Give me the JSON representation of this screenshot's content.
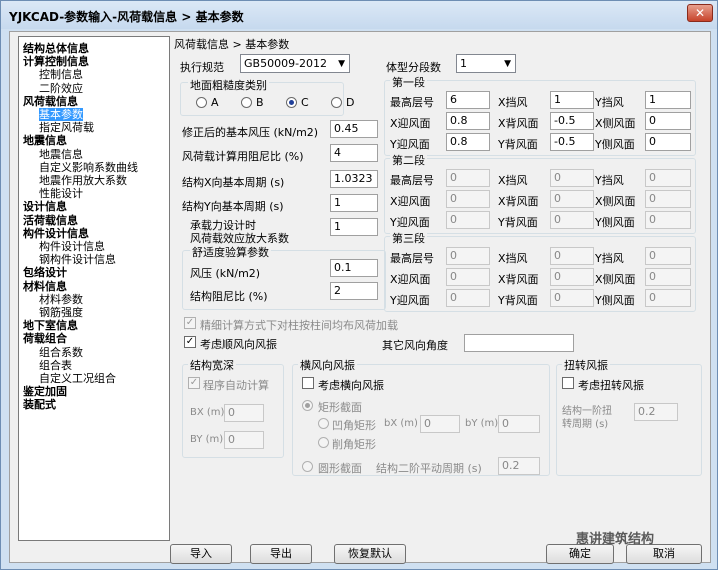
{
  "window": {
    "title": "YJKCAD-参数输入-风荷载信息 > 基本参数",
    "close": "✕"
  },
  "tree": [
    {
      "label": "结构总体信息",
      "bold": true,
      "indent": 0
    },
    {
      "label": "计算控制信息",
      "bold": true,
      "indent": 0
    },
    {
      "label": "控制信息",
      "bold": false,
      "indent": 1
    },
    {
      "label": "二阶效应",
      "bold": false,
      "indent": 1
    },
    {
      "label": "风荷载信息",
      "bold": true,
      "indent": 0
    },
    {
      "label": "基本参数",
      "bold": false,
      "indent": 1,
      "selected": true
    },
    {
      "label": "指定风荷载",
      "bold": false,
      "indent": 1
    },
    {
      "label": "地震信息",
      "bold": true,
      "indent": 0
    },
    {
      "label": "地震信息",
      "bold": false,
      "indent": 1
    },
    {
      "label": "自定义影响系数曲线",
      "bold": false,
      "indent": 1
    },
    {
      "label": "地震作用放大系数",
      "bold": false,
      "indent": 1
    },
    {
      "label": "性能设计",
      "bold": false,
      "indent": 1
    },
    {
      "label": "设计信息",
      "bold": true,
      "indent": 0
    },
    {
      "label": "活荷载信息",
      "bold": true,
      "indent": 0
    },
    {
      "label": "构件设计信息",
      "bold": true,
      "indent": 0
    },
    {
      "label": "构件设计信息",
      "bold": false,
      "indent": 1
    },
    {
      "label": "钢构件设计信息",
      "bold": false,
      "indent": 1
    },
    {
      "label": "包络设计",
      "bold": true,
      "indent": 0
    },
    {
      "label": "材料信息",
      "bold": true,
      "indent": 0
    },
    {
      "label": "材料参数",
      "bold": false,
      "indent": 1
    },
    {
      "label": "钢筋强度",
      "bold": false,
      "indent": 1
    },
    {
      "label": "地下室信息",
      "bold": true,
      "indent": 0
    },
    {
      "label": "荷载组合",
      "bold": true,
      "indent": 0
    },
    {
      "label": "组合系数",
      "bold": false,
      "indent": 1
    },
    {
      "label": "组合表",
      "bold": false,
      "indent": 1
    },
    {
      "label": "自定义工况组合",
      "bold": false,
      "indent": 1
    },
    {
      "label": "鉴定加固",
      "bold": true,
      "indent": 0
    },
    {
      "label": "装配式",
      "bold": true,
      "indent": 0
    }
  ],
  "breadcrumb": "风荷载信息 > 基本参数",
  "spec": {
    "label": "执行规范",
    "value": "GB50009-2012"
  },
  "roughness": {
    "title": "地面粗糙度类别",
    "options": [
      "A",
      "B",
      "C",
      "D"
    ],
    "selected": 2
  },
  "params": [
    {
      "label": "修正后的基本风压 (kN/m2)",
      "value": "0.45"
    },
    {
      "label": "风荷载计算用阻尼比 (%)",
      "value": "4"
    },
    {
      "label": "结构X向基本周期 (s)",
      "value": "1.0323"
    },
    {
      "label": "结构Y向基本周期 (s)",
      "value": "1"
    },
    {
      "label": "承载力设计时",
      "label2": "风荷载效应放大系数",
      "value": "1"
    }
  ],
  "comfort": {
    "title": "舒适度验算参数",
    "wind_label": "风压 (kN/m2)",
    "wind": "0.1",
    "damp_label": "结构阻尼比 (%)",
    "damp": "2"
  },
  "segments": {
    "label": "体型分段数",
    "value": "1",
    "names": [
      "第一段",
      "第二段",
      "第三段"
    ],
    "field_labels": {
      "top": "最高层号",
      "xd": "X挡风",
      "yd": "Y挡风",
      "xw": "X迎风面",
      "xb": "X背风面",
      "xs": "X侧风面",
      "yw": "Y迎风面",
      "yb": "Y背风面",
      "ys": "Y侧风面"
    },
    "data": [
      {
        "top": "6",
        "xd": "1",
        "yd": "1",
        "xw": "0.8",
        "xb": "-0.5",
        "xs": "0",
        "yw": "0.8",
        "yb": "-0.5",
        "ys": "0"
      },
      {
        "top": "0",
        "xd": "0",
        "yd": "0",
        "xw": "0",
        "xb": "0",
        "xs": "0",
        "yw": "0",
        "yb": "0",
        "ys": "0"
      },
      {
        "top": "0",
        "xd": "0",
        "yd": "0",
        "xw": "0",
        "xb": "0",
        "xs": "0",
        "yw": "0",
        "yb": "0",
        "ys": "0"
      }
    ]
  },
  "options": {
    "refined": "精细计算方式下对柱按柱间均布风荷加载",
    "along": "考虑顺风向风振",
    "other_angle": "其它风向角度",
    "other_angle_value": ""
  },
  "structwidth": {
    "title": "结构宽深",
    "auto": "程序自动计算",
    "bx_label": "BX (m)",
    "bx": "0",
    "by_label": "BY (m)",
    "by": "0"
  },
  "crosswind": {
    "title": "横风向风振",
    "consider": "考虑横向风振",
    "rect": "矩形截面",
    "concave": "凹角矩形",
    "bx_label": "bX (m)",
    "bx": "0",
    "by_label": "bY (m)",
    "by": "0",
    "chamfer": "削角矩形",
    "circle": "圆形截面",
    "period_label": "结构二阶平动周期 (s)",
    "period": "0.2"
  },
  "torsion": {
    "title": "扭转风振",
    "consider": "考虑扭转风振",
    "period_label": "结构一阶扭转周期 (s)",
    "period_line1": "结构一阶扭",
    "period_line2": "转周期 (s)",
    "period": "0.2"
  },
  "buttons": {
    "import": "导入",
    "export": "导出",
    "restore": "恢复默认",
    "ok": "确定",
    "cancel": "取消"
  },
  "watermark": "惠讲建筑结构"
}
